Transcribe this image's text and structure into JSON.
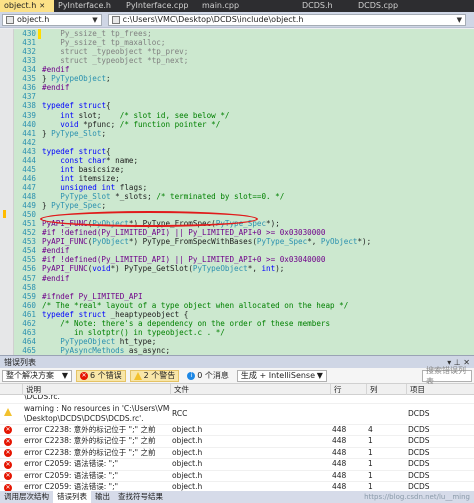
{
  "tabs": [
    {
      "label": "object.h",
      "active": true
    },
    {
      "label": "PyInterface.h",
      "active": false
    },
    {
      "label": "PyInterface.cpp",
      "active": false
    },
    {
      "label": "main.cpp",
      "active": false
    },
    {
      "label": "DCDS.h",
      "active": false
    },
    {
      "label": "DCDS.cpp",
      "active": false
    }
  ],
  "navbar": {
    "scope": "object.h",
    "path": "c:\\Users\\VMC\\Desktop\\DCDS\\include\\object.h"
  },
  "editor": {
    "lines": [
      {
        "n": "430",
        "t": "    Py_ssize_t tp_frees;"
      },
      {
        "n": "431",
        "t": "    Py_ssize_t tp_maxalloc;"
      },
      {
        "n": "432",
        "t": "    struct _typeobject *tp_prev;"
      },
      {
        "n": "433",
        "t": "    struct _typeobject *tp_next;"
      },
      {
        "n": "434",
        "t": "#endif"
      },
      {
        "n": "435",
        "t": "} PyTypeObject;"
      },
      {
        "n": "436",
        "t": "#endif"
      },
      {
        "n": "437",
        "t": ""
      },
      {
        "n": "438",
        "t": "typedef struct{"
      },
      {
        "n": "439",
        "t": "    int slot;    /* slot id, see below */"
      },
      {
        "n": "440",
        "t": "    void *pfunc; /* function pointer */"
      },
      {
        "n": "441",
        "t": "} PyType_Slot;"
      },
      {
        "n": "442",
        "t": ""
      },
      {
        "n": "443",
        "t": "typedef struct{"
      },
      {
        "n": "444",
        "t": "    const char* name;"
      },
      {
        "n": "445",
        "t": "    int basicsize;"
      },
      {
        "n": "446",
        "t": "    int itemsize;"
      },
      {
        "n": "447",
        "t": "    unsigned int flags;"
      },
      {
        "n": "448",
        "t": "    PyType_Slot *_slots; /* terminated by slot==0. */"
      },
      {
        "n": "449",
        "t": "} PyType_Spec;"
      },
      {
        "n": "450",
        "t": ""
      },
      {
        "n": "451",
        "t": "PyAPI_FUNC(PyObject*) PyType_FromSpec(PyType_Spec*);"
      },
      {
        "n": "452",
        "t": "#if !defined(Py_LIMITED_API) || Py_LIMITED_API+0 >= 0x03030000"
      },
      {
        "n": "453",
        "t": "PyAPI_FUNC(PyObject*) PyType_FromSpecWithBases(PyType_Spec*, PyObject*);"
      },
      {
        "n": "454",
        "t": "#endif"
      },
      {
        "n": "455",
        "t": "#if !defined(Py_LIMITED_API) || Py_LIMITED_API+0 >= 0x03040000"
      },
      {
        "n": "456",
        "t": "PyAPI_FUNC(void*) PyType_GetSlot(PyTypeObject*, int);"
      },
      {
        "n": "457",
        "t": "#endif"
      },
      {
        "n": "458",
        "t": ""
      },
      {
        "n": "459",
        "t": "#ifndef Py_LIMITED_API"
      },
      {
        "n": "460",
        "t": "/* The *real* layout of a type object when allocated on the heap */"
      },
      {
        "n": "461",
        "t": "typedef struct _heaptypeobject {"
      },
      {
        "n": "462",
        "t": "    /* Note: there's a dependency on the order of these members"
      },
      {
        "n": "463",
        "t": "       in slotptr() in typeobject.c . */"
      },
      {
        "n": "464",
        "t": "    PyTypeObject ht_type;"
      },
      {
        "n": "465",
        "t": "    PyAsyncMethods as_async;"
      }
    ]
  },
  "error_panel": {
    "title": "错误列表",
    "scope_combo": "整个解决方案",
    "errors_btn": "6 个错误",
    "warnings_btn": "2 个警告",
    "messages_btn": "0 个消息",
    "build_combo": "生成 + IntelliSense",
    "search_placeholder": "搜索错误列表",
    "columns": {
      "code": "",
      "desc": "说明",
      "file": "文件",
      "line": "行",
      "col": "列",
      "project": "项目"
    },
    "rows": [
      {
        "type": "partial",
        "desc": "\\DCDS.rc.",
        "file": "",
        "line": "",
        "col": "",
        "project": ""
      },
      {
        "type": "warning",
        "desc": "warning : No resources in 'C:\\Users\\VMC\n\\Desktop\\DCDS\\DCDS\\DCDS.rc'.",
        "file": "RCC",
        "line": "",
        "col": "",
        "project": "DCDS"
      },
      {
        "type": "error",
        "desc": "error C2238: 意外的标记位于 \";\" 之前",
        "file": "object.h",
        "line": "448",
        "col": "4",
        "project": "DCDS"
      },
      {
        "type": "error",
        "desc": "error C2238: 意外的标记位于 \";\" 之前",
        "file": "object.h",
        "line": "448",
        "col": "1",
        "project": "DCDS"
      },
      {
        "type": "error",
        "desc": "error C2238: 意外的标记位于 \";\" 之前",
        "file": "object.h",
        "line": "448",
        "col": "1",
        "project": "DCDS"
      },
      {
        "type": "error",
        "desc": "error C2059: 语法错误: \";\"",
        "file": "object.h",
        "line": "448",
        "col": "1",
        "project": "DCDS"
      },
      {
        "type": "error",
        "desc": "error C2059: 语法错误: \";\"",
        "file": "object.h",
        "line": "448",
        "col": "1",
        "project": "DCDS"
      },
      {
        "type": "error",
        "desc": "error C2059: 语法错误: \";\"",
        "file": "object.h",
        "line": "448",
        "col": "1",
        "project": "DCDS"
      }
    ]
  },
  "bottom_tabs": [
    {
      "label": "调用层次结构",
      "active": false
    },
    {
      "label": "错误列表",
      "active": true
    },
    {
      "label": "输出",
      "active": false
    },
    {
      "label": "查找符号结果",
      "active": false
    }
  ],
  "watermark": "https://blog.csdn.net/lu__ming"
}
